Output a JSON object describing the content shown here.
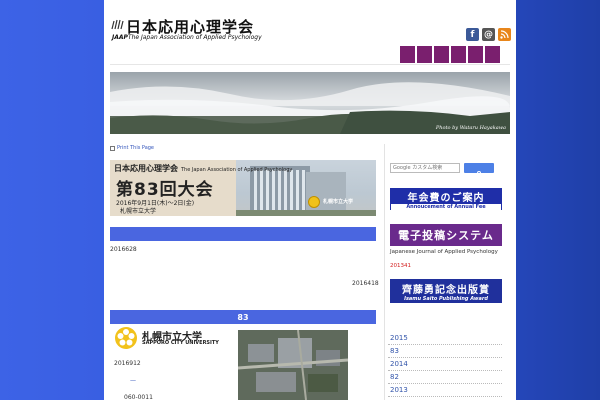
{
  "header": {
    "site_title": "日本応用心理学会",
    "abbr": "JAAP",
    "subtitle": "The Japan Association of Applied Psychology",
    "social_icons": [
      "facebook-icon",
      "email-icon",
      "rss-icon"
    ]
  },
  "banner": {
    "credit": "Photo by Wataru Hayakawa"
  },
  "print_link": "Print This Page",
  "conference": {
    "line1": "日本応用心理学会",
    "line1_en": "The Japan Association of Applied Psychology",
    "title": "第83回大会",
    "date": "2016年9月1日(木)～2日(金)",
    "venue": "札幌市立大学",
    "logo_label": "札幌市立大学"
  },
  "main": {
    "bar1": "",
    "date1": "2016628",
    "date2": "2016418",
    "bar2": "83",
    "campus_name": "札幌市立大学",
    "campus_en": "SAPPORO CITY UNIVERSITY",
    "date3": "2016912",
    "dash": "—",
    "postal": "060-0011"
  },
  "sidebar": {
    "search_placeholder": "Google カスタム検索",
    "fee_button": "年会費のご案内",
    "fee_sub": "Annoucement of Annual Fee",
    "submission_button": "電子投稿システム",
    "journal_label": "Japanese Journal of Applied Psychology",
    "journal_number": "201341",
    "award_button": "齊藤勇記念出版賞",
    "award_sub": "Isamu Saito Publishing Award",
    "archive": [
      "2015",
      "83",
      "2014",
      "82",
      "2013"
    ]
  },
  "colors": {
    "nav": "#7a1f6e",
    "bar": "#4a66e0",
    "background": "#2f54d8"
  }
}
